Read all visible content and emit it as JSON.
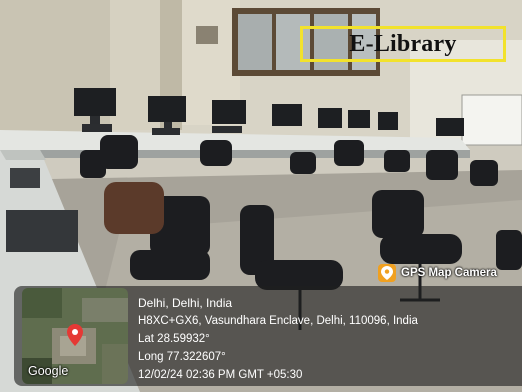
{
  "photo": {
    "label": "E-Library",
    "label_box_color": "#f2e22c"
  },
  "gps_overlay": {
    "badge_text": "GPS Map Camera",
    "badge_icon": "map-pin-icon",
    "map_attribution": "Google",
    "location_title": "Delhi, Delhi, India",
    "address": "H8XC+GX6, Vasundhara Enclave, Delhi, 110096, India",
    "latitude": "Lat 28.59932°",
    "longitude": "Long 77.322607°",
    "timestamp": "12/02/24 02:36 PM GMT +05:30"
  }
}
